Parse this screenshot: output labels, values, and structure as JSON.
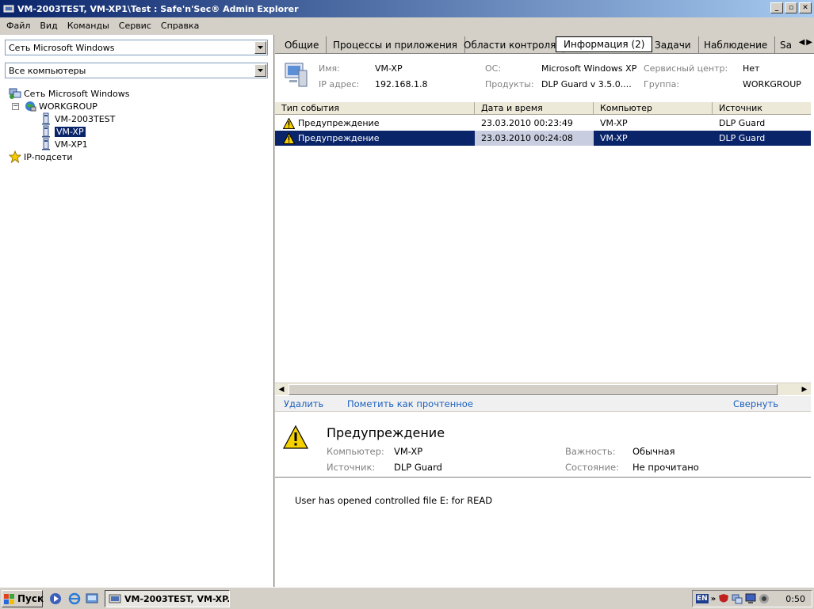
{
  "window": {
    "title": "VM-2003TEST, VM-XP1\\Test : Safe'n'Sec® Admin Explorer"
  },
  "menu": [
    "Файл",
    "Вид",
    "Команды",
    "Сервис",
    "Справка"
  ],
  "left": {
    "network_combo": "Сеть Microsoft Windows",
    "computers_combo": "Все компьютеры",
    "tree": {
      "root": "Сеть Microsoft Windows",
      "group": "WORKGROUP",
      "items": [
        "VM-2003TEST",
        "VM-XP",
        "VM-XP1"
      ],
      "selected": "VM-XP",
      "ip_subnets": "IP-подсети"
    }
  },
  "tabs": [
    "Общие",
    "Процессы и приложения",
    "Области контроля",
    "Информация (2)",
    "Задачи",
    "Наблюдение",
    "Sa"
  ],
  "active_tab": "Информация (2)",
  "info": {
    "name_label": "Имя:",
    "name_value": "VM-XP",
    "ip_label": "IP адрес:",
    "ip_value": "192.168.1.8",
    "os_label": "ОС:",
    "os_value": "Microsoft Windows XP",
    "products_label": "Продукты:",
    "products_value": "DLP Guard v 3.5.0....",
    "service_label": "Сервисный центр:",
    "service_value": "Нет",
    "group_label": "Группа:",
    "group_value": "WORKGROUP"
  },
  "list": {
    "columns": [
      "Тип события",
      "Дата и время",
      "Компьютер",
      "Источник"
    ],
    "rows": [
      {
        "type": "Предупреждение",
        "datetime": "23.03.2010 00:23:49",
        "computer": "VM-XP",
        "source": "DLP Guard"
      },
      {
        "type": "Предупреждение",
        "datetime": "23.03.2010 00:24:08",
        "computer": "VM-XP",
        "source": "DLP Guard"
      }
    ],
    "selected_row": 1
  },
  "actions": {
    "delete": "Удалить",
    "mark_read": "Пометить как прочтенное",
    "collapse": "Свернуть"
  },
  "detail": {
    "title": "Предупреждение",
    "computer_label": "Компьютер:",
    "computer_value": "VM-XP",
    "source_label": "Источник:",
    "source_value": "DLP Guard",
    "importance_label": "Важность:",
    "importance_value": "Обычная",
    "state_label": "Состояние:",
    "state_value": "Не прочитано",
    "message": "User has opened controlled file E: for READ"
  },
  "taskbar": {
    "start": "Пуск",
    "task": "VM-2003TEST, VM-XP...",
    "lang": "EN",
    "clock": "0:50"
  },
  "colors": {
    "title_start": "#0a246a",
    "title_end": "#a6caf0",
    "selection": "#0a246a",
    "link": "#1b5fbe",
    "warning": "#f5d000"
  }
}
